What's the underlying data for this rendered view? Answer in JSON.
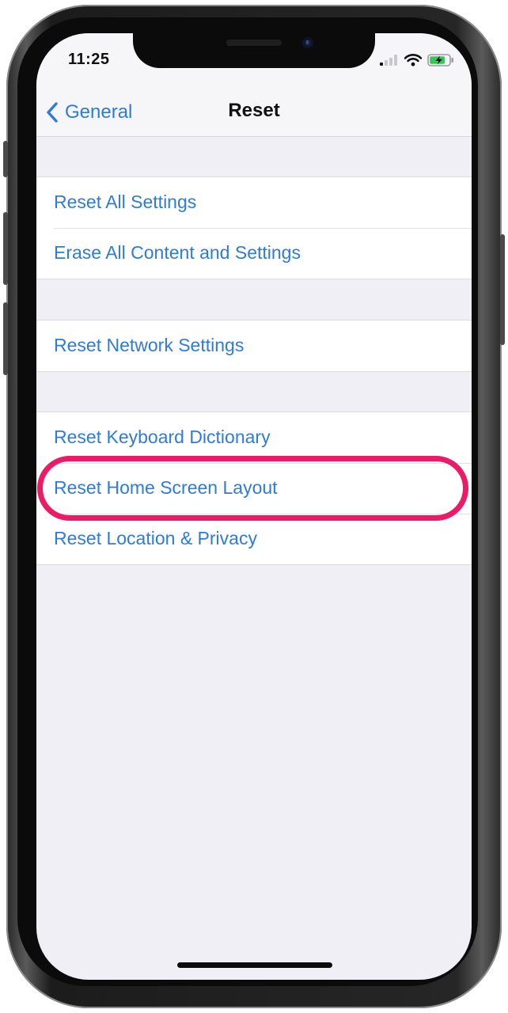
{
  "status_bar": {
    "time": "11:25"
  },
  "nav": {
    "back_label": "General",
    "title": "Reset"
  },
  "groups": [
    {
      "rows": [
        {
          "label": "Reset All Settings"
        },
        {
          "label": "Erase All Content and Settings"
        }
      ]
    },
    {
      "rows": [
        {
          "label": "Reset Network Settings"
        }
      ]
    },
    {
      "rows": [
        {
          "label": "Reset Keyboard Dictionary"
        },
        {
          "label": "Reset Home Screen Layout"
        },
        {
          "label": "Reset Location & Privacy"
        }
      ]
    }
  ],
  "annotation": {
    "highlighted_item": "Reset Home Screen Layout",
    "highlight_color": "#ec1b67"
  },
  "colors": {
    "accent": "#2f7bd8",
    "background": "#f0eff5",
    "battery": "#34c759"
  },
  "icons": {
    "back": "chevron-left-icon",
    "signal": "cellular-signal-icon",
    "wifi": "wifi-icon",
    "battery": "battery-charging-icon"
  }
}
